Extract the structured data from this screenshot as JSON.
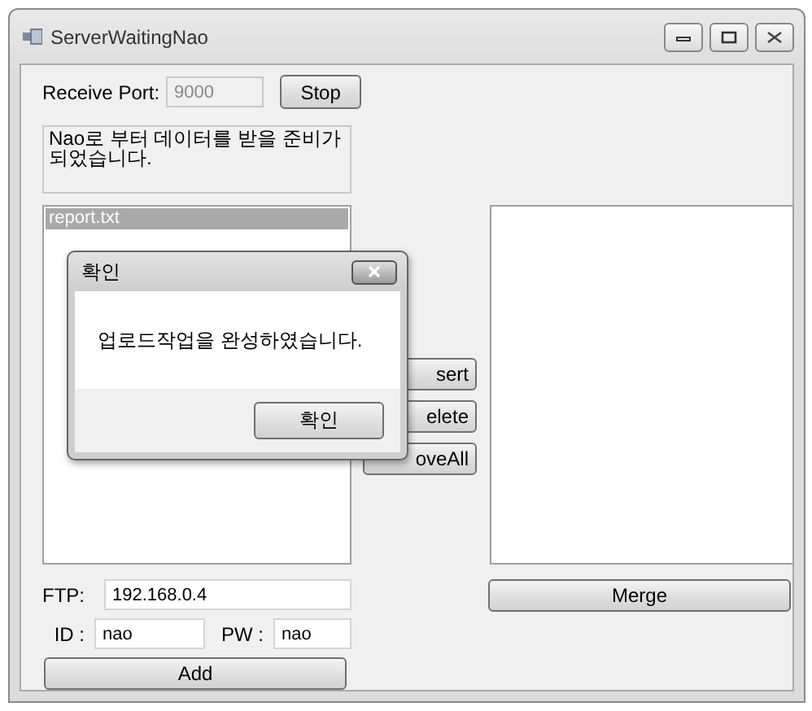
{
  "window": {
    "title": "ServerWaitingNao"
  },
  "receive_port": {
    "label": "Receive Port:",
    "value": "9000",
    "disabled": true
  },
  "stop_button": "Stop",
  "status_message": "Nao로 부터 데이터를 받을 준비가 되었습니다.",
  "file_list": [
    {
      "name": "report.txt",
      "selected": true
    }
  ],
  "list_buttons": [
    "sert",
    "elete",
    "oveAll"
  ],
  "ftp": {
    "label": "FTP:",
    "value": "192.168.0.4"
  },
  "id": {
    "label": "ID :",
    "value": "nao"
  },
  "pw": {
    "label": "PW :",
    "value": "nao"
  },
  "add_button": "Add",
  "merge_button": "Merge",
  "dialog": {
    "title": "확인",
    "message": "업로드작업을 완성하였습니다.",
    "ok_button": "확인"
  }
}
